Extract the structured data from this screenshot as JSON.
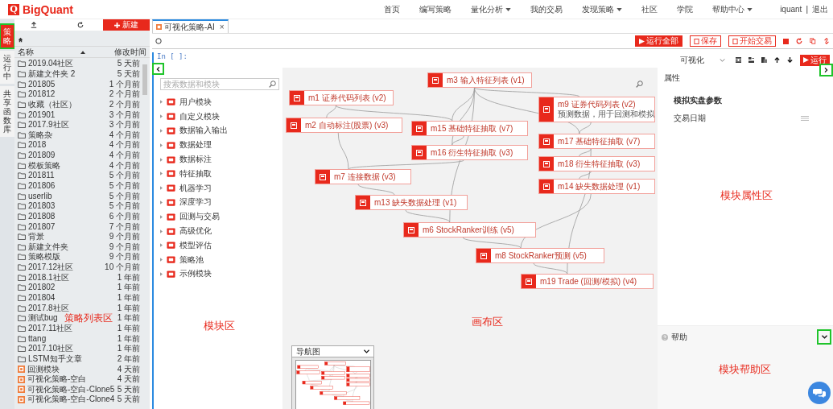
{
  "brand": {
    "logo_letter": "Q",
    "name": "BigQuant"
  },
  "nav": [
    {
      "label": "首页",
      "dropdown": false
    },
    {
      "label": "编写策略",
      "dropdown": false
    },
    {
      "label": "量化分析",
      "dropdown": true
    },
    {
      "label": "我的交易",
      "dropdown": false
    },
    {
      "label": "发现策略",
      "dropdown": true
    },
    {
      "label": "社区",
      "dropdown": false
    },
    {
      "label": "学院",
      "dropdown": false
    },
    {
      "label": "帮助中心",
      "dropdown": true
    }
  ],
  "user": {
    "name": "iquant",
    "separator": "|",
    "logout": "退出"
  },
  "side_tabs": [
    {
      "label": "策略",
      "selected": true,
      "highlighted": true
    },
    {
      "label": "运行中",
      "selected": false,
      "highlighted": false
    },
    {
      "label": "共享函数库",
      "selected": false,
      "highlighted": false
    }
  ],
  "file_panel": {
    "new_button": "新建",
    "columns": [
      "名称",
      "修改时间"
    ],
    "annotation": "策略列表区",
    "items": [
      {
        "name": "2019.04社区",
        "time": "5 天前",
        "kind": "folder"
      },
      {
        "name": "新建文件夹 2",
        "time": "5 天前",
        "kind": "folder"
      },
      {
        "name": "201805",
        "time": "1 个月前",
        "kind": "folder"
      },
      {
        "name": "201812",
        "time": "2 个月前",
        "kind": "folder"
      },
      {
        "name": "收藏（社区）",
        "time": "2 个月前",
        "kind": "folder"
      },
      {
        "name": "201901",
        "time": "3 个月前",
        "kind": "folder"
      },
      {
        "name": "2017.9社区",
        "time": "3 个月前",
        "kind": "folder"
      },
      {
        "name": "策略杂",
        "time": "4 个月前",
        "kind": "folder"
      },
      {
        "name": "2018",
        "time": "4 个月前",
        "kind": "folder"
      },
      {
        "name": "201809",
        "time": "4 个月前",
        "kind": "folder"
      },
      {
        "name": "模板策略",
        "time": "4 个月前",
        "kind": "folder"
      },
      {
        "name": "201811",
        "time": "5 个月前",
        "kind": "folder"
      },
      {
        "name": "201806",
        "time": "5 个月前",
        "kind": "folder"
      },
      {
        "name": "userlib",
        "time": "5 个月前",
        "kind": "folder"
      },
      {
        "name": "201803",
        "time": "5 个月前",
        "kind": "folder"
      },
      {
        "name": "201808",
        "time": "6 个月前",
        "kind": "folder"
      },
      {
        "name": "201807",
        "time": "7 个月前",
        "kind": "folder"
      },
      {
        "name": "背景",
        "time": "9 个月前",
        "kind": "folder"
      },
      {
        "name": "新建文件夹",
        "time": "9 个月前",
        "kind": "folder"
      },
      {
        "name": "策略模版",
        "time": "9 个月前",
        "kind": "folder"
      },
      {
        "name": "2017.12社区",
        "time": "10 个月前",
        "kind": "folder"
      },
      {
        "name": "2018.1社区",
        "time": "1 年前",
        "kind": "folder"
      },
      {
        "name": "201802",
        "time": "1 年前",
        "kind": "folder"
      },
      {
        "name": "201804",
        "time": "1 年前",
        "kind": "folder"
      },
      {
        "name": "2017.8社区",
        "time": "1 年前",
        "kind": "folder"
      },
      {
        "name": "测试bug",
        "time": "1 年前",
        "kind": "folder"
      },
      {
        "name": "2017.11社区",
        "time": "1 年前",
        "kind": "folder"
      },
      {
        "name": "ttang",
        "time": "1 年前",
        "kind": "folder"
      },
      {
        "name": "2017.10社区",
        "time": "1 年前",
        "kind": "folder"
      },
      {
        "name": "LSTM知乎文章",
        "time": "2 年前",
        "kind": "folder"
      },
      {
        "name": "回测模块",
        "time": "4 天前",
        "kind": "strategy"
      },
      {
        "name": "可视化策略-空白",
        "time": "4 天前",
        "kind": "strategy"
      },
      {
        "name": "可视化策略-空白-Clone5",
        "time": "5 天前",
        "kind": "strategy"
      },
      {
        "name": "可视化策略-空白-Clone4",
        "time": "5 天前",
        "kind": "strategy"
      }
    ]
  },
  "editor_tab": {
    "title": "可视化策略-AI",
    "close": "×"
  },
  "toolbar": [
    {
      "label": "运行全部",
      "kind": "primary"
    },
    {
      "label": "保存",
      "kind": "outline"
    },
    {
      "label": "开始交易",
      "kind": "outline"
    }
  ],
  "cell": {
    "prompt": "In [ ]:",
    "mode": "可视化",
    "run_button": "运行"
  },
  "modules": {
    "collapse_highlighted": true,
    "search_placeholder": "搜索数据和模块",
    "annotation": "模块区",
    "items": [
      "用户模块",
      "自定义模块",
      "数据输入输出",
      "数据处理",
      "数据标注",
      "特征抽取",
      "机器学习",
      "深度学习",
      "回测与交易",
      "高级优化",
      "模型评估",
      "策略池",
      "示例模块"
    ]
  },
  "canvas": {
    "annotation": "画布区",
    "navigator_title": "导航图",
    "nodes": [
      {
        "label": "m3 输入特征列表 (v1)"
      },
      {
        "label": "m1 证券代码列表 (v2)"
      },
      {
        "label": "m9 证券代码列表 (v2)",
        "note": "预测数据，用于回测和模拟"
      },
      {
        "label": "m2 自动标注(股票) (v3)"
      },
      {
        "label": "m15 基础特征抽取 (v7)"
      },
      {
        "label": "m17 基础特征抽取 (v7)"
      },
      {
        "label": "m16 衍生特征抽取 (v3)"
      },
      {
        "label": "m18 衍生特征抽取 (v3)"
      },
      {
        "label": "m7 连接数据 (v3)"
      },
      {
        "label": "m14 缺失数据处理 (v1)"
      },
      {
        "label": "m13 缺失数据处理 (v1)"
      },
      {
        "label": "m6 StockRanker训练 (v5)"
      },
      {
        "label": "m8 StockRanker预测 (v5)"
      },
      {
        "label": "m19 Trade (回测/模拟) (v4)"
      }
    ]
  },
  "properties": {
    "title": "属性",
    "collapse_highlighted": true,
    "section": "模拟实盘参数",
    "fields": [
      "交易日期"
    ],
    "annotation": "模块属性区"
  },
  "help": {
    "title": "帮助",
    "toggle_highlighted": true,
    "annotation": "模块帮助区"
  }
}
